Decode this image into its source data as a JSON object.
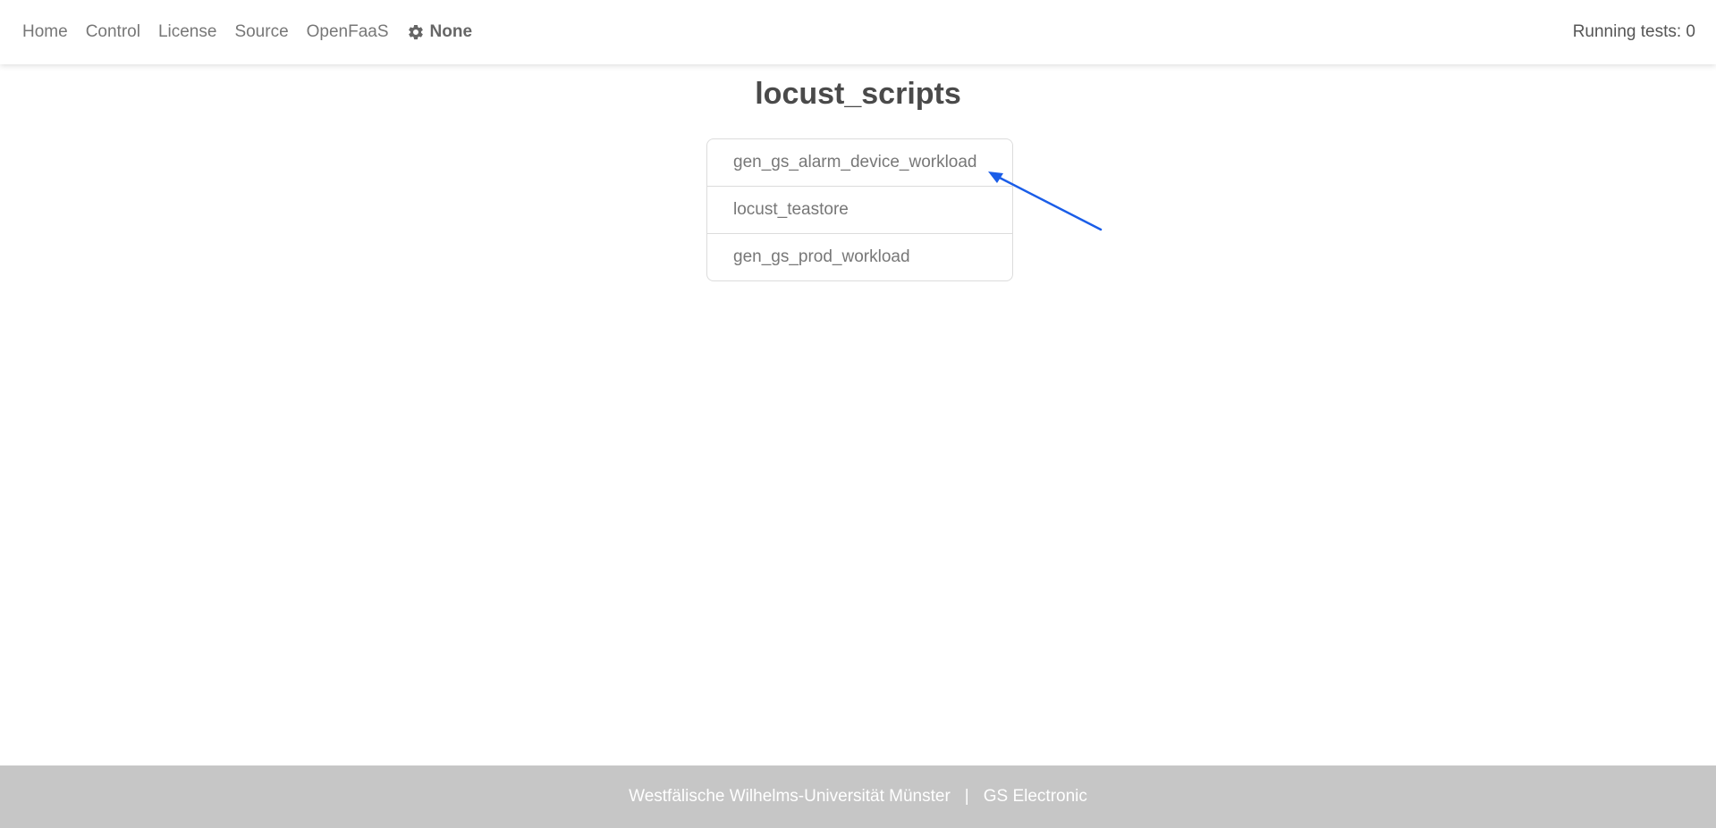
{
  "nav": {
    "links": [
      "Home",
      "Control",
      "License",
      "Source",
      "OpenFaaS"
    ],
    "user": {
      "icon": "gear-icon",
      "label": "None"
    },
    "running_tests": "Running tests: 0"
  },
  "main": {
    "title": "locust_scripts",
    "scripts": [
      "gen_gs_alarm_device_workload",
      "locust_teastore",
      "gen_gs_prod_workload"
    ]
  },
  "annotation": {
    "color": "#1a5de8"
  },
  "footer": {
    "left": "Westfälische Wilhelms-Universität Münster",
    "separator": "|",
    "right": "GS Electronic"
  }
}
